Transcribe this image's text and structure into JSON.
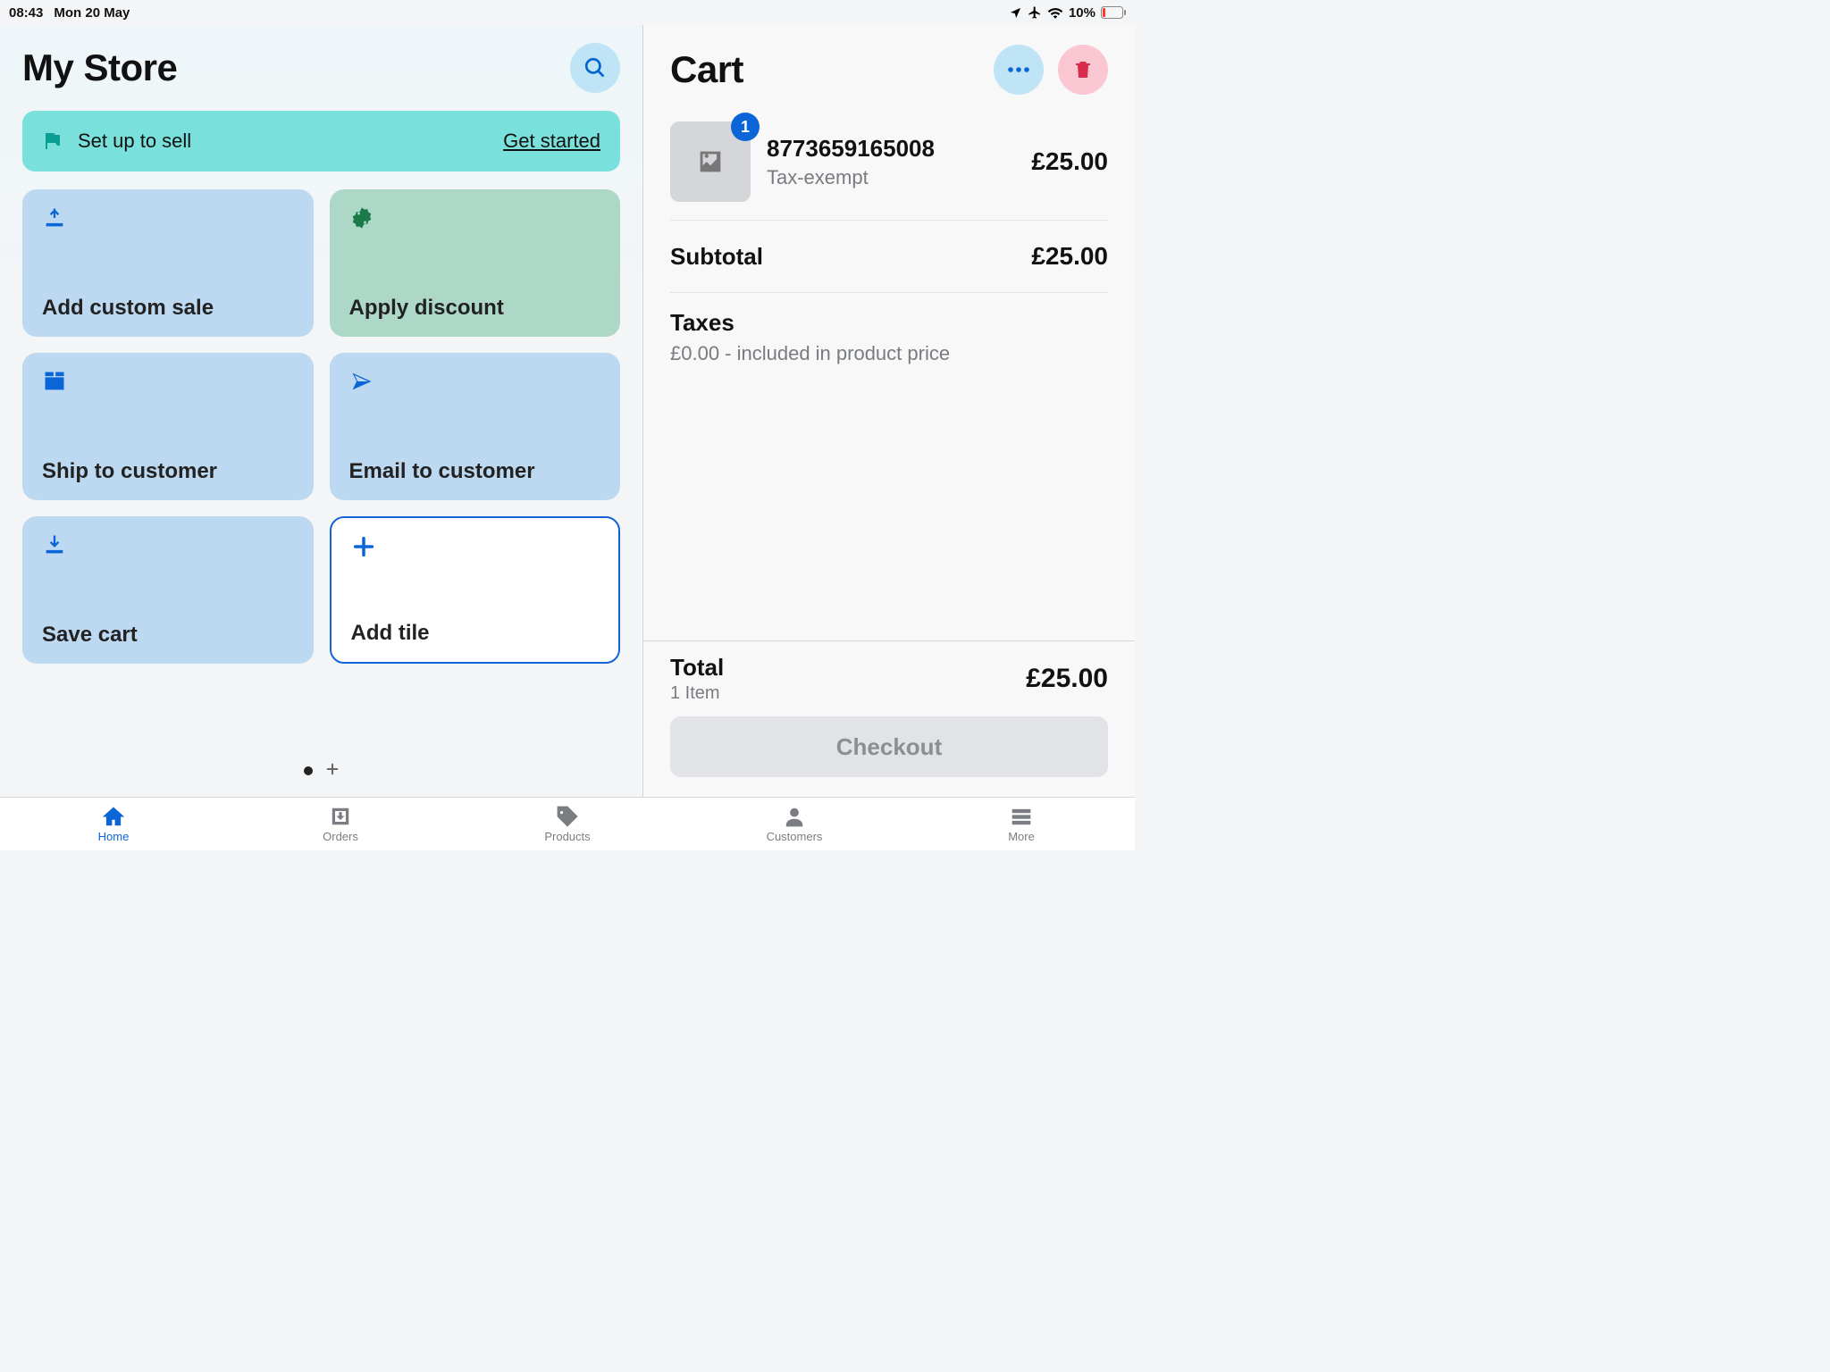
{
  "status": {
    "time": "08:43",
    "date": "Mon 20 May",
    "battery": "10%"
  },
  "store": {
    "title": "My Store",
    "setup": {
      "label": "Set up to sell",
      "cta": "Get started"
    },
    "tiles": {
      "add_custom_sale": "Add custom sale",
      "apply_discount": "Apply discount",
      "ship_to_customer": "Ship to customer",
      "email_to_customer": "Email to customer",
      "save_cart": "Save cart",
      "add_tile": "Add tile"
    }
  },
  "cart": {
    "title": "Cart",
    "item": {
      "qty_badge": "1",
      "name": "8773659165008",
      "sub": "Tax-exempt",
      "price": "£25.00"
    },
    "subtotal": {
      "label": "Subtotal",
      "value": "£25.00"
    },
    "taxes": {
      "label": "Taxes",
      "sub": "£0.00 - included in product price"
    },
    "total": {
      "label": "Total",
      "sub": "1 Item",
      "value": "£25.00"
    },
    "checkout": "Checkout"
  },
  "tabs": {
    "home": "Home",
    "orders": "Orders",
    "products": "Products",
    "customers": "Customers",
    "more": "More"
  }
}
